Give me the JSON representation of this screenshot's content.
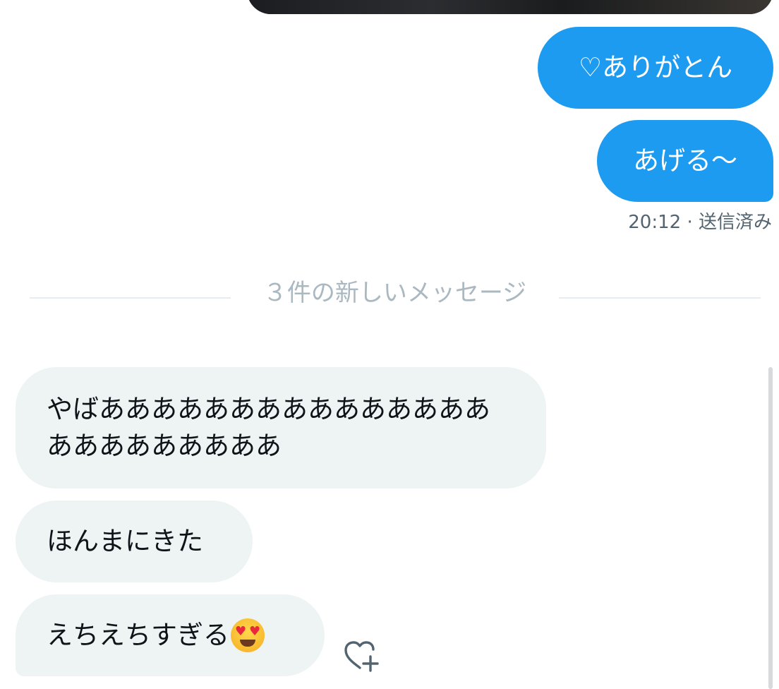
{
  "conversation": {
    "outgoing": [
      {
        "text": "♡ありがとん"
      },
      {
        "text": "あげる〜"
      }
    ],
    "sent_time": "20:12",
    "sent_status": "· 送信済み",
    "new_messages_divider": "３件の新しいメッセージ",
    "incoming": [
      {
        "text": "やばああああああああああああああああああああああああ"
      },
      {
        "text": "ほんまにきた"
      },
      {
        "text": "えちえちすぎる"
      }
    ],
    "last_message_emoji": "heart-eyes-emoji"
  },
  "icons": {
    "react": "add-reaction-heart-icon"
  },
  "colors": {
    "outgoing_bubble": "#1d9bf0",
    "incoming_bubble": "#eef3f4",
    "divider_text": "#aab8c2",
    "meta_text": "#536471"
  }
}
